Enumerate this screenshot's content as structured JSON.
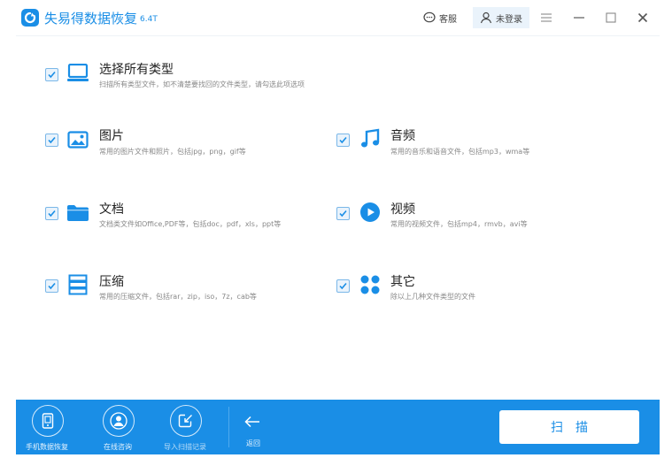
{
  "app": {
    "title": "失易得数据恢复",
    "version": "6.4T",
    "brand_color": "#1a8ee6"
  },
  "titlebar": {
    "feedback_label": "客服",
    "login_label": "未登录",
    "menu_icon": "hamburger-icon",
    "minimize_icon": "minimize-icon",
    "maximize_icon": "maximize-icon",
    "close_icon": "close-icon"
  },
  "select_all": {
    "checked": true,
    "icon": "monitor-icon",
    "title": "选择所有类型",
    "desc": "扫描所有类型文件，如不清楚要找回的文件类型，请勾选此项选项"
  },
  "types": [
    {
      "key": "image",
      "checked": true,
      "icon": "image-icon",
      "title": "图片",
      "desc": "常用的图片文件和照片，包括jpg，png，gif等"
    },
    {
      "key": "audio",
      "checked": true,
      "icon": "music-icon",
      "title": "音频",
      "desc": "常用的音乐和语音文件，包括mp3，wma等"
    },
    {
      "key": "document",
      "checked": true,
      "icon": "folder-icon",
      "title": "文档",
      "desc": "文档类文件如Office,PDF等，包括doc，pdf，xls，ppt等"
    },
    {
      "key": "video",
      "checked": true,
      "icon": "play-icon",
      "title": "视频",
      "desc": "常用的视频文件，包括mp4，rmvb，avi等"
    },
    {
      "key": "archive",
      "checked": true,
      "icon": "archive-icon",
      "title": "压缩",
      "desc": "常用的压缩文件，包括rar，zip，iso，7z，cab等"
    },
    {
      "key": "other",
      "checked": true,
      "icon": "grid-dots-icon",
      "title": "其它",
      "desc": "除以上几种文件类型的文件"
    }
  ],
  "bottombar": {
    "phone_recovery": "手机数据恢复",
    "online_consult": "在线咨询",
    "import_record": "导入扫描记录",
    "back_label": "返回",
    "scan_label": "扫描"
  }
}
